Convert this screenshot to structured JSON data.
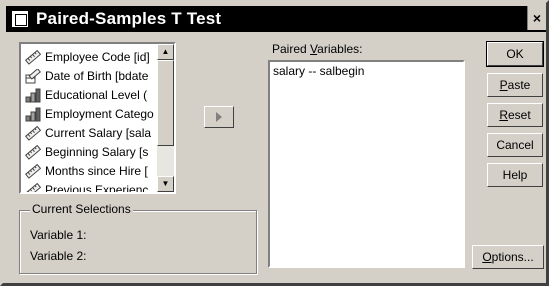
{
  "window": {
    "title": "Paired-Samples T Test",
    "close_glyph": "×"
  },
  "source_list": {
    "items": [
      {
        "label": "Employee Code [id]",
        "icon": "scale-ruler-icon"
      },
      {
        "label": "Date of Birth [bdate",
        "icon": "date-ruler-icon"
      },
      {
        "label": "Educational Level (",
        "icon": "ordinal-bars-icon"
      },
      {
        "label": "Employment Catego",
        "icon": "ordinal-bars-icon"
      },
      {
        "label": "Current Salary [sala",
        "icon": "scale-ruler-icon"
      },
      {
        "label": "Beginning Salary [s",
        "icon": "scale-ruler-icon"
      },
      {
        "label": "Months since Hire [",
        "icon": "scale-ruler-icon"
      },
      {
        "label": "Previous Experienc",
        "icon": "scale-ruler-icon"
      }
    ]
  },
  "paired": {
    "label_pre": "Paired ",
    "label_u": "V",
    "label_post": "ariables:",
    "items": [
      "salary -- salbegin"
    ]
  },
  "current_selections": {
    "title": "Current Selections",
    "var1": "Variable 1:",
    "var2": "Variable 2:"
  },
  "buttons": {
    "ok": "OK",
    "paste_u": "P",
    "paste_rest": "aste",
    "reset_u": "R",
    "reset_rest": "eset",
    "cancel": "Cancel",
    "help": "Help",
    "options_u": "O",
    "options_rest": "ptions..."
  }
}
